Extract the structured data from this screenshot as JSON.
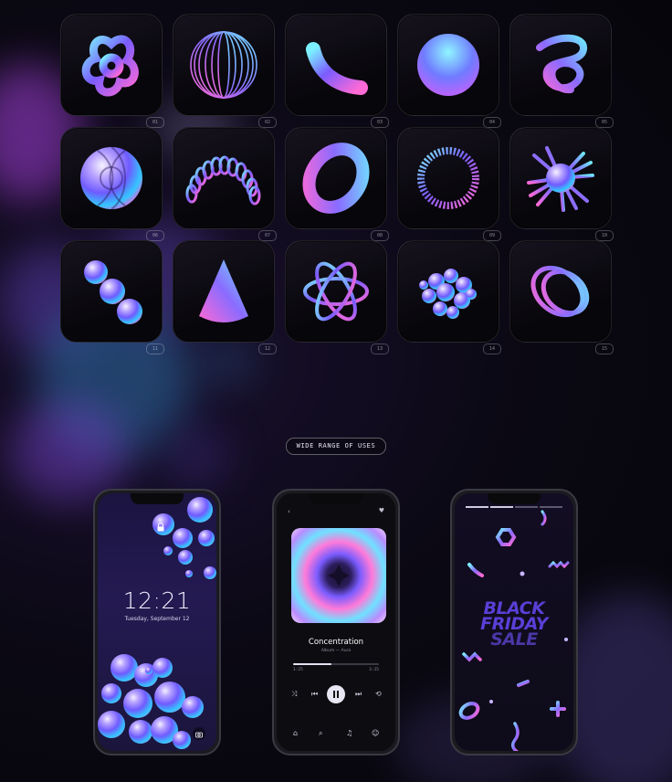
{
  "shapes": {
    "tiles": [
      {
        "num": "01",
        "shape": "trefoil-knot"
      },
      {
        "num": "02",
        "shape": "wire-sphere"
      },
      {
        "num": "03",
        "shape": "curved-capsule"
      },
      {
        "num": "04",
        "shape": "textured-sphere"
      },
      {
        "num": "05",
        "shape": "tangled-loop"
      },
      {
        "num": "06",
        "shape": "twisted-torus"
      },
      {
        "num": "07",
        "shape": "coil-arch"
      },
      {
        "num": "08",
        "shape": "torus-ring"
      },
      {
        "num": "09",
        "shape": "coil-ring"
      },
      {
        "num": "10",
        "shape": "spiky-ball"
      },
      {
        "num": "11",
        "shape": "bead-chain"
      },
      {
        "num": "12",
        "shape": "cone"
      },
      {
        "num": "13",
        "shape": "atom-orbits"
      },
      {
        "num": "14",
        "shape": "bubble-cluster"
      },
      {
        "num": "15",
        "shape": "spiral-ring"
      }
    ]
  },
  "section_label": "WIDE RANGE OF USES",
  "phone_lock": {
    "time": "12:21",
    "date": "Tuesday, September 12",
    "lock_icon": "lock-icon",
    "camera_icon": "camera-icon"
  },
  "phone_music": {
    "song": "Concentration",
    "artist": "Album — Aura",
    "elapsed": "1:25",
    "total": "3:15",
    "progress": 0.45,
    "icons": [
      "shuffle-icon",
      "previous-icon",
      "pause-icon",
      "next-icon",
      "repeat-icon"
    ],
    "nav_icons": [
      "home-icon",
      "search-icon",
      "music-note-icon",
      "profile-icon"
    ]
  },
  "phone_promo": {
    "line1": "BLACK",
    "line2": "FRIDAY",
    "line3": "SALE"
  },
  "colors": {
    "accent_violet": "#7a5cff",
    "accent_cyan": "#33c6ff",
    "accent_pink": "#ff5bd6",
    "background": "#08060d"
  }
}
